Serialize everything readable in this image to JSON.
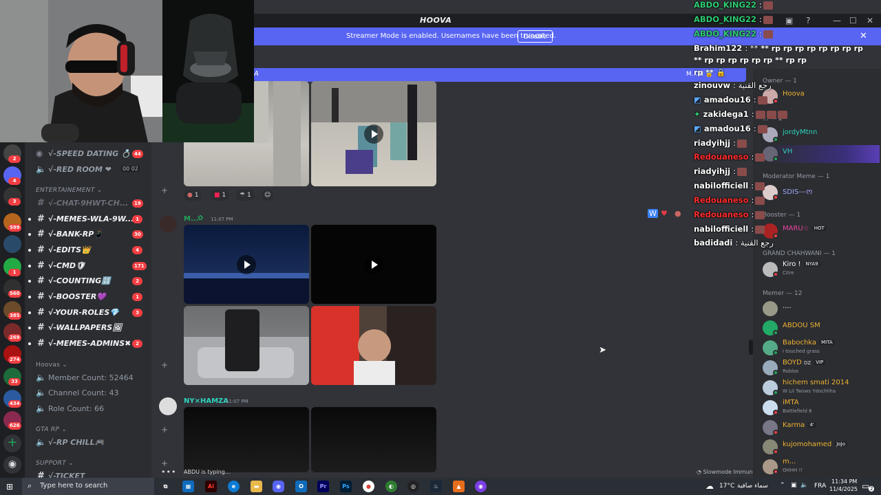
{
  "window": {
    "title": "HOOVA",
    "streamer_message": "Streamer Mode is enabled. Usernames have been truncated.",
    "disable_label": "Disable"
  },
  "rail_badges": [
    "2",
    "4",
    "3",
    "599",
    "1",
    "560",
    "385",
    "269",
    "274",
    "33",
    "434",
    "626"
  ],
  "sidebar": {
    "top_channels": [
      {
        "label": "√-SPEED DATING 💍",
        "badge": "44"
      },
      {
        "label": "√-RED ROOM ❤",
        "extra": "00 02"
      }
    ],
    "cat_entertainment": "ENTERTAINEMENT",
    "entertainment_channels": [
      {
        "label": "√-CHAT-9HWT-CH...",
        "badge": "19"
      },
      {
        "label": "√-MEMES-WLA-9W...",
        "badge": "1"
      },
      {
        "label": "√-BANK-RP📱",
        "badge": "30"
      },
      {
        "label": "√-EDITS👑",
        "badge": "4"
      },
      {
        "label": "√-CMD🛡",
        "badge": "171"
      },
      {
        "label": "√-COUNTING🔢",
        "badge": "2"
      },
      {
        "label": "√-BOOSTER💜",
        "badge": "1"
      },
      {
        "label": "√-YOUR-ROLES💎",
        "badge": "3"
      },
      {
        "label": "√-WALLPAPERS🖼",
        "badge": ""
      },
      {
        "label": "√-MEMES-ADMINS✖",
        "badge": "2"
      }
    ],
    "cat_hoovas": "Hoovas",
    "stats": [
      "Member Count: 52464",
      "Channel Count: 43",
      "Role Count: 66"
    ],
    "cat_gta": "GTA RP",
    "gta_channel": "√-RP CHILL🎮",
    "cat_support": "SUPPORT",
    "support_channel": "√-TICKET"
  },
  "chat": {
    "header_label": "A",
    "header_right": "M... d 🔒",
    "reactions": [
      "1",
      "1",
      "1"
    ],
    "msg1_author": "M...",
    "msg1_time": "11:07 PM",
    "msg2_author": "NY×HAMZA",
    "msg2_time": "11:07 PM",
    "typing": "ABDU is typing...",
    "slowmode": "Slowmode Immune"
  },
  "stream_chat": [
    {
      "name": "ABDO_KING22",
      "color": "#2ecc71",
      "text": ":"
    },
    {
      "name": "ABDO_KING22",
      "color": "#2ecc71",
      "text": ":"
    },
    {
      "name": "ABDO_KING22",
      "color": "#2ecc71",
      "text": ":"
    },
    {
      "name": "Brahim122",
      "color": "#ffffff",
      "text": ": **"
    },
    {
      "name": "zinouvw",
      "color": "#ffffff",
      "text": ": رجع القنية"
    },
    {
      "name": "amadou16",
      "color": "#ffffff",
      "text": ":"
    },
    {
      "name": "zakidega1",
      "color": "#ffffff",
      "text": ":"
    },
    {
      "name": "amadou16",
      "color": "#ffffff",
      "text": ":"
    },
    {
      "name": "riadyihjj",
      "color": "#ffffff",
      "text": ":"
    },
    {
      "name": "Redouaneso",
      "color": "#ff2b2b",
      "text": ":"
    },
    {
      "name": "riadyihjj",
      "color": "#ffffff",
      "text": ":"
    },
    {
      "name": "nabilofficiell",
      "color": "#ffffff",
      "text": ":"
    },
    {
      "name": "Redouaneso",
      "color": "#ff2b2b",
      "text": ":"
    },
    {
      "name": "Redouaneso",
      "color": "#ff2b2b",
      "text": ":"
    },
    {
      "name": "nabilofficiell",
      "color": "#ffffff",
      "text": ":"
    },
    {
      "name": "badidadi",
      "color": "#ffffff",
      "text": ": رجع القنية"
    }
  ],
  "rp_line_1": "** rp rp rp rp rp rp rp rp",
  "rp_line_2": "** rp rp rp rp rp rp ** rp rp",
  "rp_line_3": "rp ** 🔒",
  "members": {
    "owner_header": "Owner — 1",
    "owner": "Hoova",
    "group2_header": "... — 2",
    "jordy": "jordyMtnn",
    "vh": "VH",
    "moderator_header": "Moderator Meme — 1",
    "moderator": "SDIS---ᰔ",
    "booster_header": "Booster — 1",
    "booster": "MARU☆",
    "booster_tag": "HOT",
    "grand_header": "GRAND CHAHWANI — 1",
    "grand": "Kiro !",
    "grand_tag": "NYA9",
    "grand_sub": "Citre",
    "memer_header": "Memer — 12",
    "m1": "....",
    "m2": "ABDOU SM",
    "m3": "Babochka",
    "m3_tag": "MITA",
    "m3_sub": "i touched grass",
    "m4": "BOYD",
    "m4_dz": "DZ",
    "m4_tag": "VIP",
    "m4_sub": "Roblox",
    "m5": "hichem smati 2014",
    "m5_sub": "W Lii Twsws Ydochliha",
    "m6": "iMTA",
    "m6_sub": "Battlefield 6",
    "m7": "Karma",
    "m7_tag": "4'",
    "m8": "kujomohamed",
    "m8_tag": "JoJo",
    "m9": "m...",
    "m9_sub": "OHHH !!"
  },
  "taskbar": {
    "search_placeholder": "Type here to search",
    "weather": "17°C",
    "weather_text": "سماء صافية",
    "lang": "FRA",
    "time": "11:34 PM",
    "date": "11/4/2025",
    "notif": "2"
  }
}
